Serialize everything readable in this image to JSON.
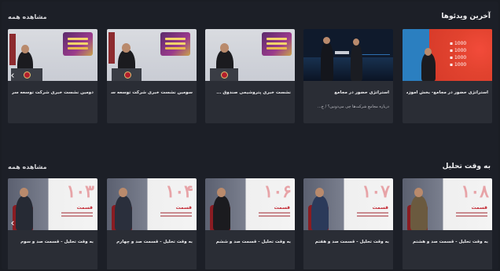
{
  "sections": [
    {
      "title": "آخرین ویدئوها",
      "see_all": "مشاهده همه",
      "cards": [
        {
          "title": "استراتژی حضور در مجامع- بخش آموزش",
          "subtitle": "",
          "thumb": "map"
        },
        {
          "title": "استراتژی حضور در مجامع",
          "subtitle": "درباره مجامع شرکت‌ها چی می‌دونین؟ / چ...",
          "thumb": "dark"
        },
        {
          "title": "نشست خبری پتروشیمی صندوق ...",
          "subtitle": "",
          "thumb": "conf3"
        },
        {
          "title": "سومین نشست خبری شرکت توسعه سرمای...",
          "subtitle": "",
          "thumb": "conf2"
        },
        {
          "title": "دومین نشست خبری شرکت توسعه سرمای...",
          "subtitle": "",
          "thumb": "conf1"
        }
      ]
    },
    {
      "title": "به وقت تحلیل",
      "see_all": "مشاهده همه",
      "cards": [
        {
          "title": "به وقت تحلیل - قسمت صد و هشتم",
          "number": "۱۰۸",
          "episode": "قسمت"
        },
        {
          "title": "به وقت تحلیل - قسمت صد و هفتم",
          "number": "۱۰۷",
          "episode": "قسمت"
        },
        {
          "title": "به وقت تحلیل - قسمت صد و ششم",
          "number": "۱۰۶",
          "episode": "قسمت"
        },
        {
          "title": "به وقت تحلیل - قسمت صد و چهارم",
          "number": "۱۰۴",
          "episode": "قسمت"
        },
        {
          "title": "به وقت تحلیل - قسمت صد و سوم",
          "number": "۱۰۳",
          "episode": "قسمت"
        }
      ]
    }
  ],
  "icons": {
    "carousel_prev": "chevron-left-icon"
  },
  "colors": {
    "background": "#1c1f27",
    "card": "#2a2d35",
    "accent_number": "#e7a3a7"
  }
}
